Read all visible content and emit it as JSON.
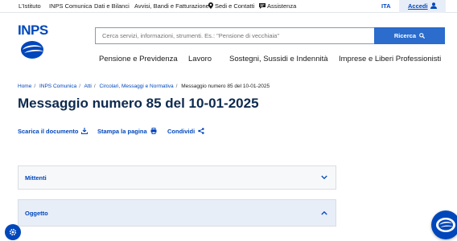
{
  "topbar": {
    "links": [
      "L'Istituto",
      "INPS Comunica",
      "Dati e Bilanci",
      "Avvisi, Bandi e Fatturazione",
      "Sedi e Contatti",
      "Assistenza"
    ],
    "language": "ITA",
    "login_label": "Accedi"
  },
  "logo": {
    "text": "INPS"
  },
  "search": {
    "placeholder": "Cerca servizi, informazioni, strumenti. Es.: \"Pensione di vecchiaia\"",
    "button_label": "Ricerca"
  },
  "nav": {
    "items": [
      "Pensione e Previdenza",
      "Lavoro",
      "Sostegni, Sussidi e Indennità",
      "Imprese e Liberi Professionisti"
    ]
  },
  "breadcrumb": [
    "Home",
    "INPS Comunica",
    "Atti",
    "Circolari, Messaggi e Normativa",
    "Messaggio numero 85 del 10-01-2025"
  ],
  "page": {
    "title": "Messaggio numero 85 del 10-01-2025"
  },
  "actions": {
    "download_label": "Scarica il documento",
    "print_label": "Stampa la pagina",
    "share_label": "Condividi"
  },
  "accordion": [
    {
      "label": "Mittenti",
      "expanded": false
    },
    {
      "label": "Oggetto",
      "expanded": true
    }
  ],
  "icons": {
    "sedi": "map-pin-icon",
    "assistenza": "chat-bubble-icon",
    "user": "user-icon",
    "search": "search-icon",
    "download": "download-icon",
    "print": "printer-icon",
    "share": "share-icon",
    "settings": "gear-icon",
    "chat": "chat-assistant-icon"
  },
  "colors": {
    "brand": "#0047bb",
    "title": "#0d2a4e",
    "search_button": "#2b6ccc"
  }
}
